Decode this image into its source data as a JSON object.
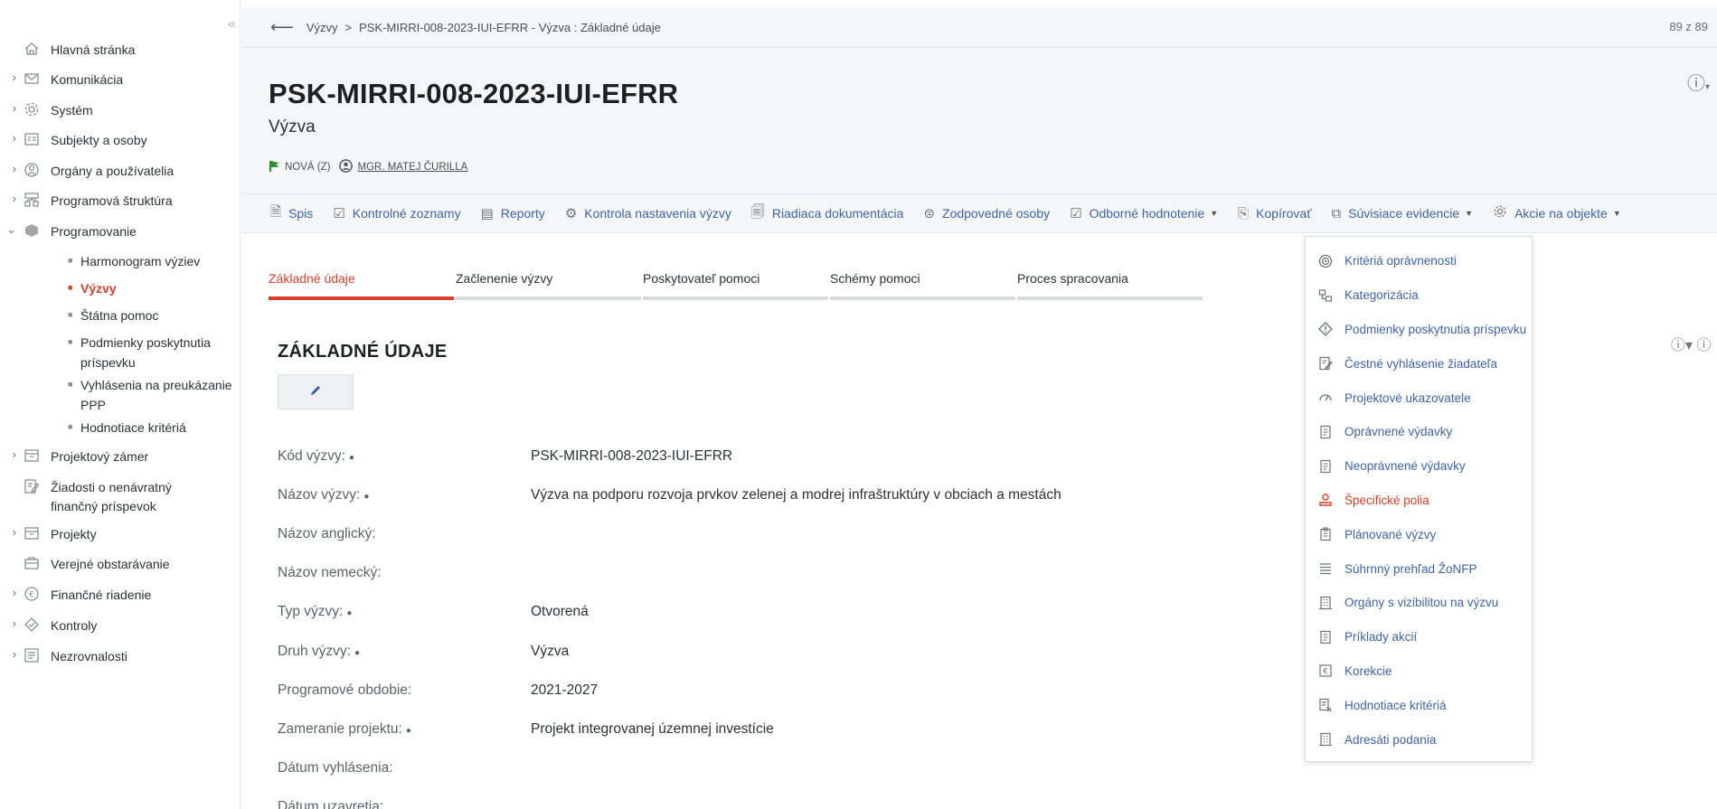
{
  "sidebar": {
    "collapse_glyph": "«",
    "items": [
      {
        "label": "Hlavná stránka",
        "icon": "home-icon",
        "has_children": false
      },
      {
        "label": "Komunikácia",
        "icon": "envelope-icon",
        "has_children": true
      },
      {
        "label": "Systém",
        "icon": "gear-icon",
        "has_children": true
      },
      {
        "label": "Subjekty a osoby",
        "icon": "id-card-icon",
        "has_children": true
      },
      {
        "label": "Orgány a používatelia",
        "icon": "user-circle-icon",
        "has_children": true
      },
      {
        "label": "Programová štruktúra",
        "icon": "hierarchy-icon",
        "has_children": true
      },
      {
        "label": "Programovanie",
        "icon": "cube-icon",
        "has_children": true,
        "expanded": true
      },
      {
        "label": "Projektový zámer",
        "icon": "archive-icon",
        "has_children": true
      },
      {
        "label": "Žiadosti o nenávratný finančný príspevok",
        "icon": "form-edit-icon",
        "has_children": false
      },
      {
        "label": "Projekty",
        "icon": "archive-icon",
        "has_children": true
      },
      {
        "label": "Verejné obstarávanie",
        "icon": "briefcase-icon",
        "has_children": false
      },
      {
        "label": "Finančné riadenie",
        "icon": "euro-icon",
        "has_children": true
      },
      {
        "label": "Kontroly",
        "icon": "diamond-check-icon",
        "has_children": true
      },
      {
        "label": "Nezrovnalosti",
        "icon": "list-alert-icon",
        "has_children": true
      }
    ],
    "sub_items": [
      {
        "label": "Harmonogram výziev",
        "active": false
      },
      {
        "label": "Výzvy",
        "active": true
      },
      {
        "label": "Štátna pomoc",
        "active": false
      },
      {
        "label": "Podmienky poskytnutia príspevku",
        "active": false
      },
      {
        "label": "Vyhlásenia na preukázanie PPP",
        "active": false
      },
      {
        "label": "Hodnotiace kritériá",
        "active": false
      }
    ]
  },
  "breadcrumb": {
    "items": [
      "Výzvy",
      "PSK-MIRRI-008-2023-IUI-EFRR - Výzva : Základné údaje"
    ],
    "separator": ">"
  },
  "page_count": "89 z 89",
  "header": {
    "title": "PSK-MIRRI-008-2023-IUI-EFRR",
    "subtitle": "Výzva",
    "status": "NOVÁ (Z)",
    "user": "MGR. MATEJ ČURILLA",
    "flag_color": "#2e8b2e"
  },
  "toolbar": [
    {
      "label": "Spis",
      "icon": "file-icon",
      "dropdown": false
    },
    {
      "label": "Kontrolné zoznamy",
      "icon": "checkbox-icon",
      "dropdown": false
    },
    {
      "label": "Reporty",
      "icon": "report-icon",
      "dropdown": false
    },
    {
      "label": "Kontrola nastavenia výzvy",
      "icon": "settings-check-icon",
      "dropdown": false
    },
    {
      "label": "Riadiaca dokumentácia",
      "icon": "document-icon",
      "dropdown": false
    },
    {
      "label": "Zodpovedné osoby",
      "icon": "person-icon",
      "dropdown": false
    },
    {
      "label": "Odborné hodnotenie",
      "icon": "checkbox-icon",
      "dropdown": true
    },
    {
      "label": "Kopírovať",
      "icon": "copy-icon",
      "dropdown": false
    },
    {
      "label": "Súvisiace evidencie",
      "icon": "related-icon",
      "dropdown": true
    },
    {
      "label": "Akcie na objekte",
      "icon": "gear-icon",
      "dropdown": true
    }
  ],
  "tabs": [
    {
      "label": "Základné údaje",
      "active": true
    },
    {
      "label": "Začlenenie výzvy",
      "active": false
    },
    {
      "label": "Poskytovateľ pomoci",
      "active": false
    },
    {
      "label": "Schémy pomoci",
      "active": false
    },
    {
      "label": "Proces spracovania",
      "active": false
    }
  ],
  "section": {
    "title": "ZÁKLADNÉ ÚDAJE",
    "edit_icon": "pencil-icon"
  },
  "fields": [
    {
      "label": "Kód výzvy:",
      "required": true,
      "value": "PSK-MIRRI-008-2023-IUI-EFRR"
    },
    {
      "label": "Názov výzvy:",
      "required": true,
      "value": "Výzva na podporu rozvoja prvkov zelenej a modrej infraštruktúry v obciach a mestách"
    },
    {
      "label": "Názov anglický:",
      "required": false,
      "value": ""
    },
    {
      "label": "Názov nemecký:",
      "required": false,
      "value": ""
    },
    {
      "label": "Typ výzvy:",
      "required": true,
      "value": "Otvorená"
    },
    {
      "label": "Druh výzvy:",
      "required": true,
      "value": "Výzva"
    },
    {
      "label": "Programové obdobie:",
      "required": false,
      "value": "2021-2027"
    },
    {
      "label": "Zameranie projektu:",
      "required": true,
      "value": "Projekt integrovanej územnej investície"
    },
    {
      "label": "Dátum vyhlásenia:",
      "required": false,
      "value": ""
    },
    {
      "label": "Dátum uzavretia:",
      "required": false,
      "value": ""
    }
  ],
  "dropdown": {
    "items": [
      {
        "label": "Kritériá oprávnenosti",
        "icon": "target-icon",
        "active": false
      },
      {
        "label": "Kategorizácia",
        "icon": "category-icon",
        "active": false
      },
      {
        "label": "Podmienky poskytnutia príspevku",
        "icon": "warning-diamond-icon",
        "active": false
      },
      {
        "label": "Čestné vyhlásenie žiadateľa",
        "icon": "signed-document-icon",
        "active": false
      },
      {
        "label": "Projektové ukazovatele",
        "icon": "gauge-icon",
        "active": false
      },
      {
        "label": "Oprávnené výdavky",
        "icon": "receipt-icon",
        "active": false
      },
      {
        "label": "Neoprávnené výdavky",
        "icon": "receipt-icon",
        "active": false
      },
      {
        "label": "Špecifické polia",
        "icon": "user-stamp-icon",
        "active": true
      },
      {
        "label": "Plánované výzvy",
        "icon": "clipboard-icon",
        "active": false
      },
      {
        "label": "Súhrnný prehľad ŽoNFP",
        "icon": "list-icon",
        "active": false
      },
      {
        "label": "Orgány s vizibilitou na výzvu",
        "icon": "building-icon",
        "active": false
      },
      {
        "label": "Príklady akcií",
        "icon": "receipt-icon",
        "active": false
      },
      {
        "label": "Korekcie",
        "icon": "euro-box-icon",
        "active": false
      },
      {
        "label": "Hodnotiace kritériá",
        "icon": "evaluation-icon",
        "active": false
      },
      {
        "label": "Adresáti podania",
        "icon": "building-icon",
        "active": false
      }
    ]
  },
  "colors": {
    "accent": "#d5402b",
    "link": "#3f64a8",
    "header_bg": "#f4f6f8"
  }
}
